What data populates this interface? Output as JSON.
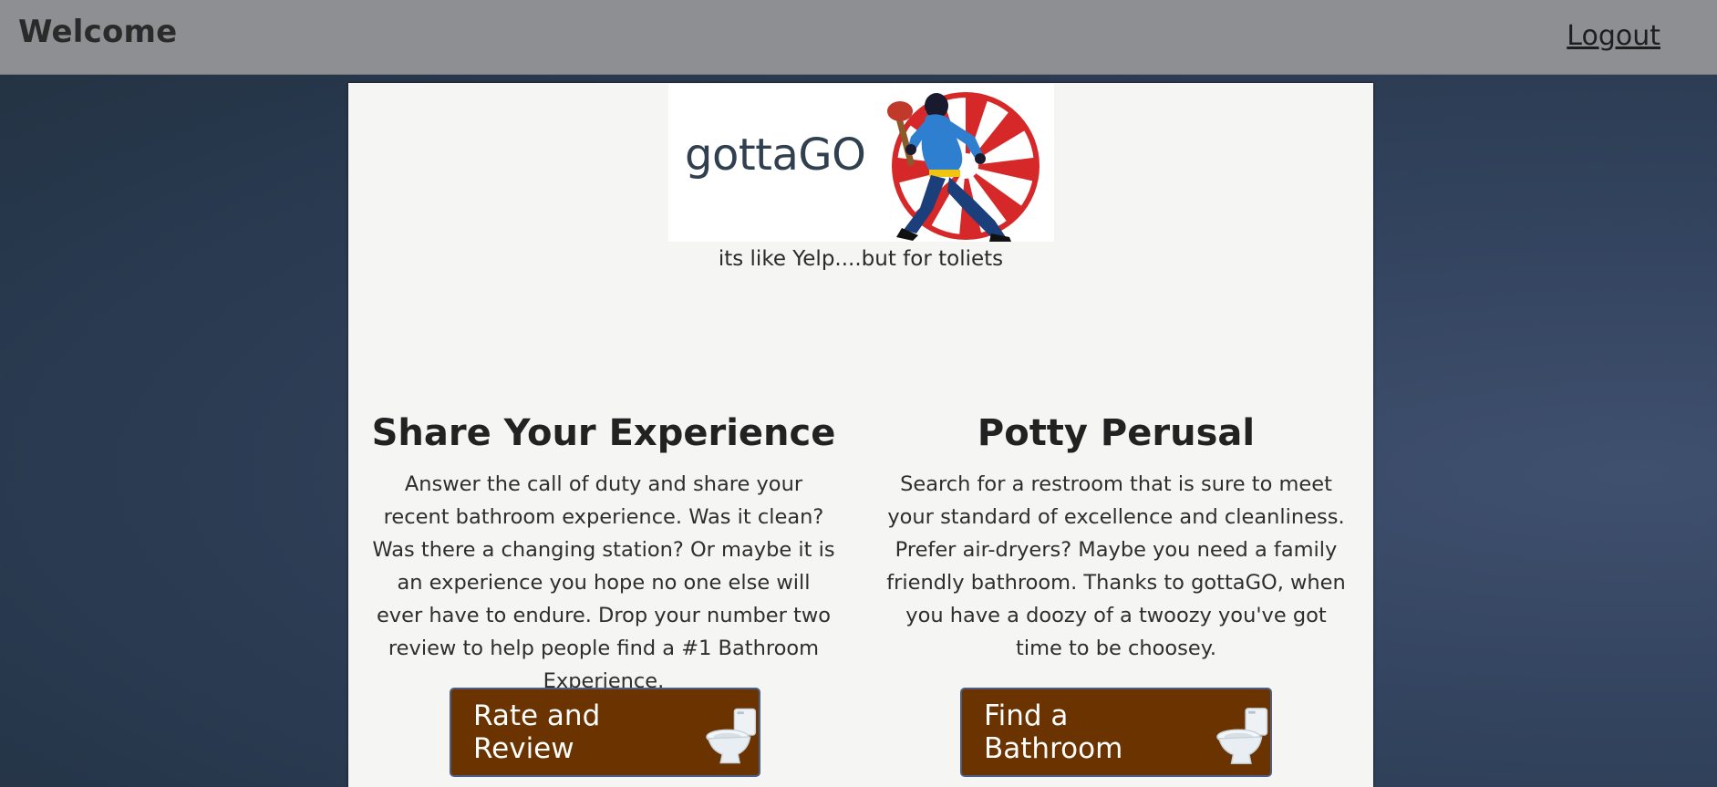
{
  "navbar": {
    "title": "Welcome",
    "logout_label": "Logout"
  },
  "logo": {
    "text": "gottaGO",
    "icon": "plunger-superhero-logo"
  },
  "tagline": "its like Yelp....but for toliets",
  "sections": {
    "share": {
      "heading": "Share Your Experience",
      "body": "Answer the call of duty and share your recent bathroom experience. Was it clean? Was there a changing station? Or maybe it is an experience you hope no one else will ever have to endure. Drop your number two review to help people find a #1 Bathroom Experience.",
      "button_label": "Rate and Review",
      "button_icon": "toilet-icon"
    },
    "perusal": {
      "heading": "Potty Perusal",
      "body": "Search for a restroom that is sure to meet your standard of excellence and cleanliness. Prefer air-dryers? Maybe you need a family friendly bathroom. Thanks to gottaGO, when you have a doozy of a twoozy you've got time to be choosey.",
      "button_label": "Find a Bathroom",
      "button_icon": "toilet-icon"
    }
  },
  "colors": {
    "navbar_bg": "#8e8f92",
    "panel_bg": "#f5f5f3",
    "button_bg": "#6b3300",
    "page_bg": "#2c3c52"
  }
}
